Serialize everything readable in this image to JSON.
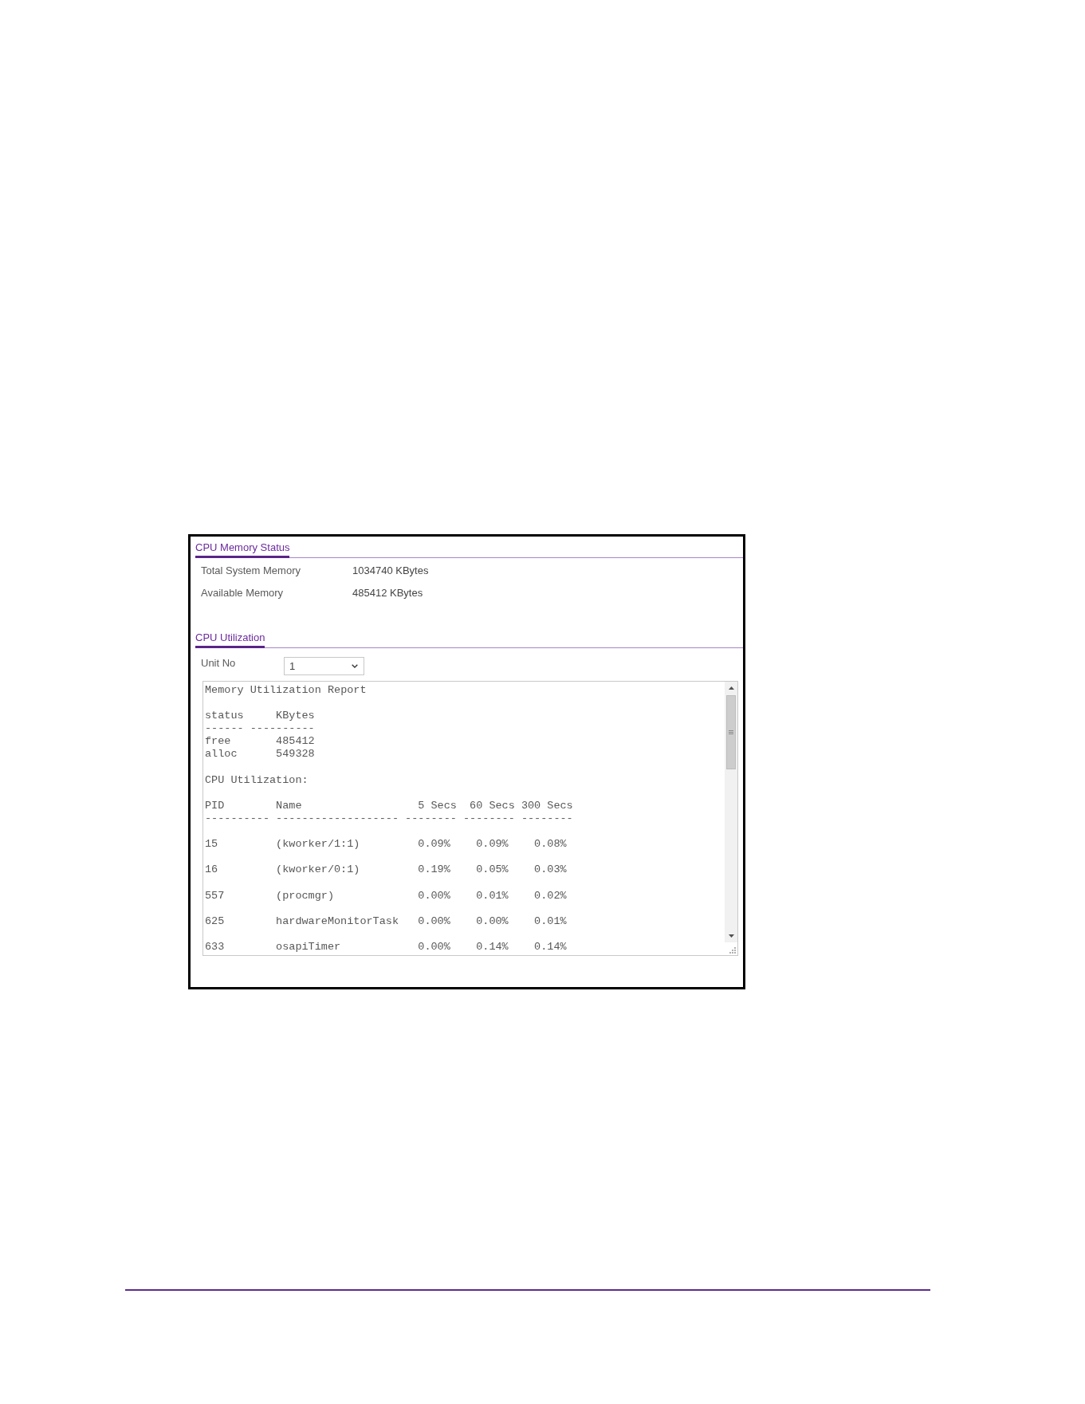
{
  "memory_status": {
    "title": "CPU Memory Status",
    "fields": [
      {
        "label": "Total System Memory",
        "value": "1034740 KBytes"
      },
      {
        "label": "Available Memory",
        "value": "485412 KBytes"
      }
    ]
  },
  "cpu_utilization": {
    "title": "CPU Utilization",
    "unit_no": {
      "label": "Unit No",
      "value": "1"
    },
    "report": {
      "title": "Memory Utilization Report",
      "memory_table": {
        "columns": [
          "status",
          "KBytes"
        ],
        "rules": [
          "------",
          "----------"
        ],
        "rows": [
          [
            "free",
            "485412"
          ],
          [
            "alloc",
            "549328"
          ]
        ]
      },
      "cpu_heading": "CPU Utilization:",
      "cpu_table": {
        "columns": [
          "PID",
          "Name",
          "5 Secs",
          "60 Secs",
          "300 Secs"
        ],
        "rules": [
          "----------",
          "-------------------",
          "--------",
          "--------",
          "--------"
        ],
        "rows": [
          [
            "15",
            "(kworker/1:1)",
            "0.09%",
            "0.09%",
            "0.08%"
          ],
          [
            "16",
            "(kworker/0:1)",
            "0.19%",
            "0.05%",
            "0.03%"
          ],
          [
            "557",
            "(procmgr)",
            "0.00%",
            "0.01%",
            "0.02%"
          ],
          [
            "625",
            "hardwareMonitorTask",
            "0.00%",
            "0.00%",
            "0.01%"
          ],
          [
            "633",
            "osapiTimer",
            "0.00%",
            "0.14%",
            "0.14%"
          ]
        ]
      }
    }
  }
}
